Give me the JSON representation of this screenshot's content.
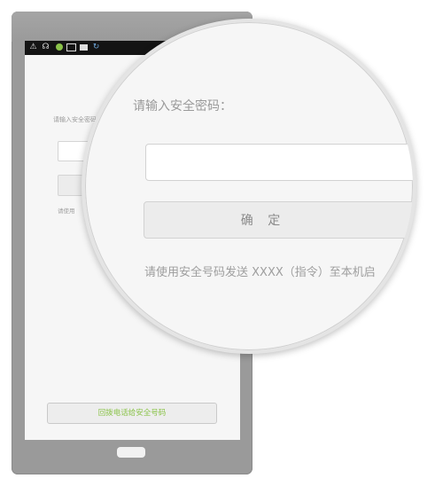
{
  "status_bar": {
    "icons": [
      "warning-icon",
      "headset-icon",
      "notification-dot-icon",
      "image-icon",
      "briefcase-icon",
      "sync-icon"
    ],
    "accent_dot_color": "#8bc34a"
  },
  "form": {
    "prompt": "请输入安全密码：",
    "confirm_label": "确 定",
    "hint": "请使用安全号码发送 XXXX（指令）至本机启",
    "small_prompt": "请输入安全密码",
    "small_hint": "请使用"
  },
  "footer": {
    "callback_label": "回拨电话给安全号码",
    "callback_color": "#8bc34a"
  }
}
